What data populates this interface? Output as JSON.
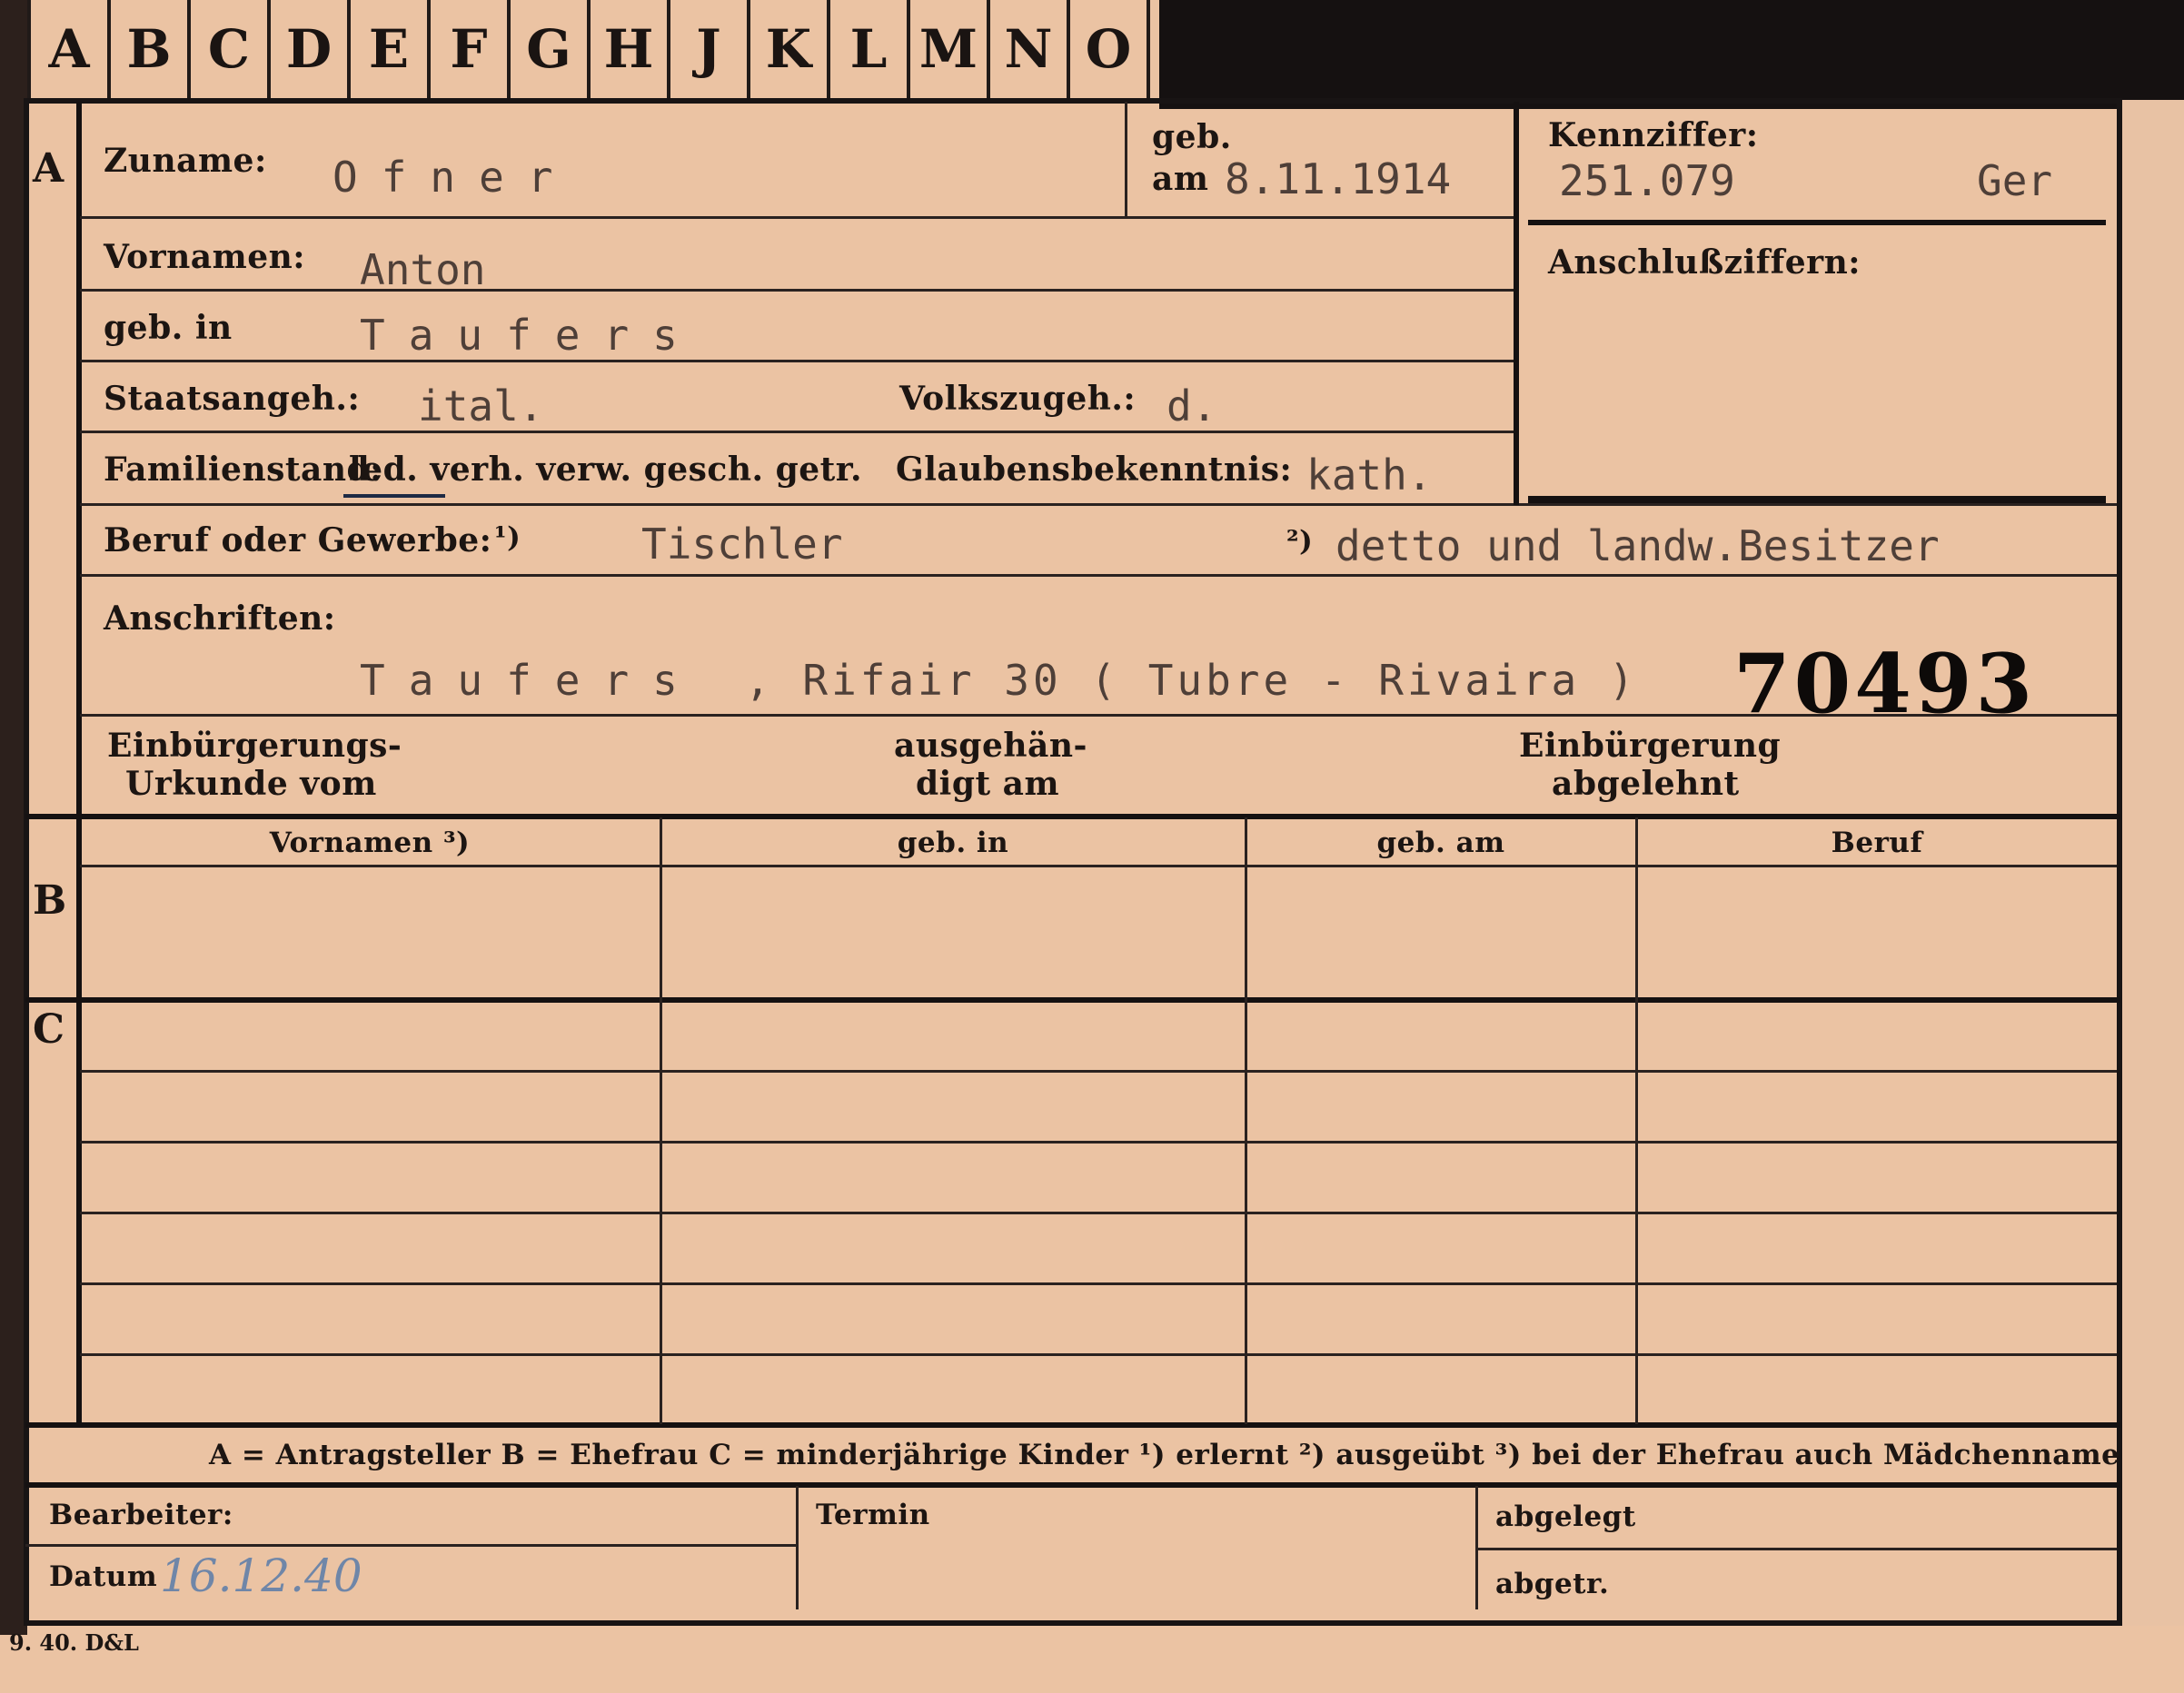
{
  "tabs": [
    "A",
    "B",
    "C",
    "D",
    "E",
    "F",
    "G",
    "H",
    "J",
    "K",
    "L",
    "M",
    "N",
    "O"
  ],
  "sections": {
    "a": "A",
    "b": "B",
    "c": "C"
  },
  "form": {
    "zuname_label": "Zuname:",
    "zuname_value": "Ofner",
    "geb_label": "geb.",
    "am_label": "am",
    "geb_am_value": "8.11.1914",
    "kennziffer_label": "Kennziffer:",
    "kennziffer_value": "251.079",
    "kennziffer_suffix": "Ger",
    "anschluss_label": "Anschlußziffern:",
    "vornamen_label": "Vornamen:",
    "vornamen_value": "Anton",
    "geb_in_label": "geb. in",
    "geb_in_value": "Taufers",
    "staatsangeh_label": "Staatsangeh.:",
    "staatsangeh_value": "ital.",
    "volkszugeh_label": "Volkszugeh.:",
    "volkszugeh_value": "d.",
    "familienstand_label": "Familienstand:",
    "familienstand_options": "led. verh. verw. gesch. getr.",
    "glaubens_label": "Glaubensbekenntnis:",
    "glaubens_value": "kath.",
    "beruf_label": "Beruf oder Gewerbe:",
    "beruf_note1": "¹)",
    "beruf_value1": "Tischler",
    "beruf_note2": "²)",
    "beruf_value2": "detto und landw.Besitzer",
    "anschriften_label": "Anschriften:",
    "anschrift_ort": "Taufers",
    "anschrift_rest": ", Rifair 30 ( Tubre - Rivaira )",
    "stamp_number": "70493",
    "einb_urkunde_l1": "Einbürgerungs-",
    "einb_urkunde_l2": "Urkunde vom",
    "ausgehaen_l1": "ausgehän-",
    "ausgehaen_l2": "digt am",
    "einb_abgelehnt_l1": "Einbürgerung",
    "einb_abgelehnt_l2": "abgelehnt"
  },
  "table": {
    "headers": [
      "Vornamen ³)",
      "geb. in",
      "geb. am",
      "Beruf"
    ]
  },
  "legend": "A = Antragsteller   B = Ehefrau   C = minderjährige Kinder   ¹) erlernt   ²) ausgeübt   ³) bei der Ehefrau auch Mädchenname",
  "footer": {
    "bearbeiter_label": "Bearbeiter:",
    "datum_label": "Datum",
    "datum_value": "16.12.40",
    "termin_label": "Termin",
    "abgelegt_label": "abgelegt",
    "abgetr_label": "abgetr."
  },
  "print_code": "9. 40. D&L"
}
